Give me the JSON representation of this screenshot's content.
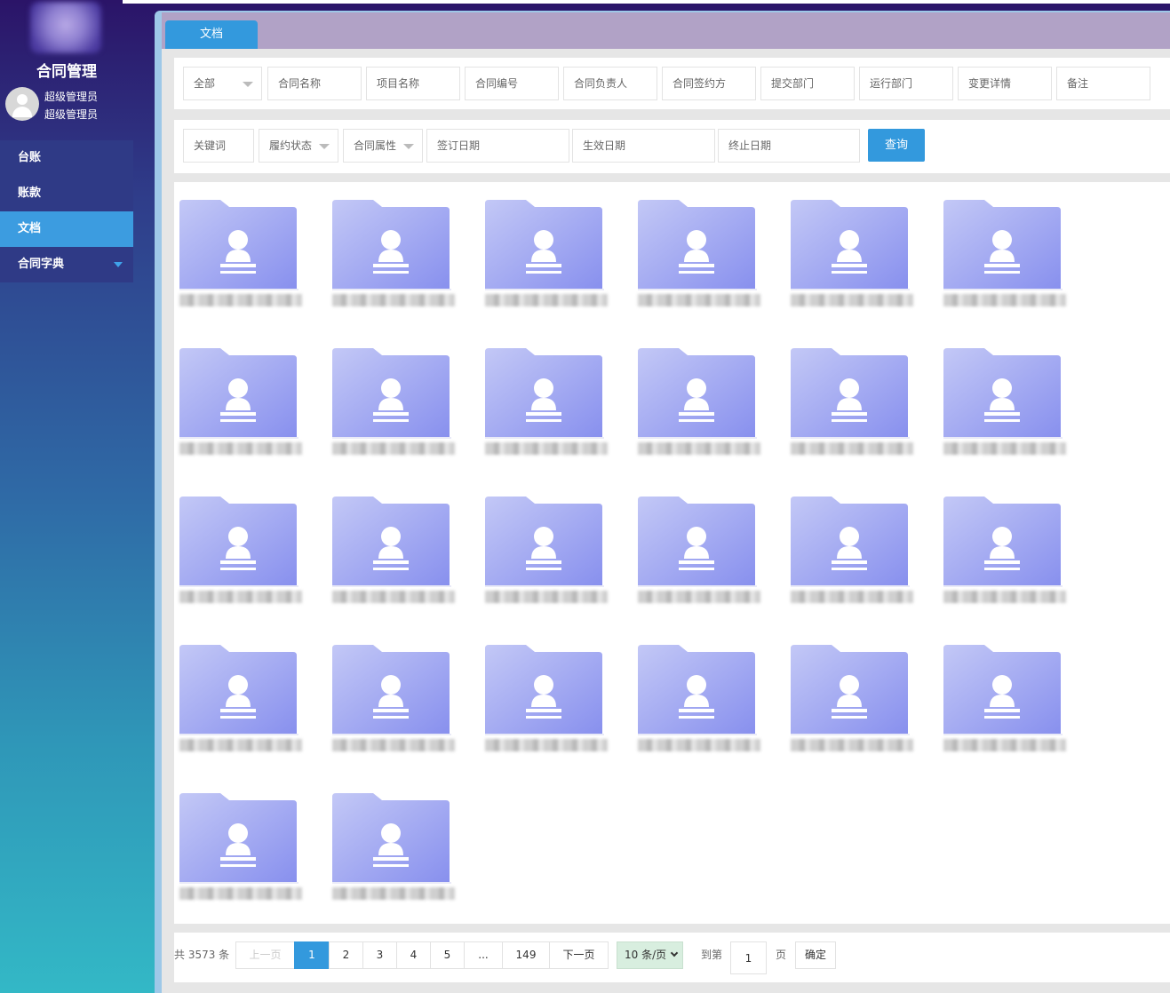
{
  "app": {
    "title": "合同管理"
  },
  "user": {
    "line1": "超级管理员",
    "line2": "超级管理员"
  },
  "menu": [
    {
      "label": "台账"
    },
    {
      "label": "账款"
    },
    {
      "label": "文档"
    },
    {
      "label": "合同字典"
    }
  ],
  "tab": {
    "label": "文档"
  },
  "filters_row1": {
    "type_select": "全部",
    "contract_name": "合同名称",
    "project_name": "项目名称",
    "contract_no": "合同编号",
    "contract_owner": "合同负责人",
    "signing_party": "合同签约方",
    "submit_dept": "提交部门",
    "operation_dept": "运行部门",
    "change_details": "变更详情",
    "remarks": "备注"
  },
  "filters_row2": {
    "keyword": "关键词",
    "performance_status": "履约状态",
    "contract_attr": "合同属性",
    "sign_date": "签订日期",
    "effective_date": "生效日期",
    "end_date": "终止日期",
    "query_button": "查询"
  },
  "folders_count": 26,
  "pagination": {
    "total": "共 3573 条",
    "prev": "上一页",
    "pages": [
      "1",
      "2",
      "3",
      "4",
      "5",
      "...",
      "149"
    ],
    "next": "下一页",
    "page_size": "10 条/页",
    "goto_label": "到第",
    "goto_value": "1",
    "page_unit": "页",
    "confirm": "确定"
  },
  "colors": {
    "accent": "#3399dd",
    "folder": "#9aa4f0"
  }
}
